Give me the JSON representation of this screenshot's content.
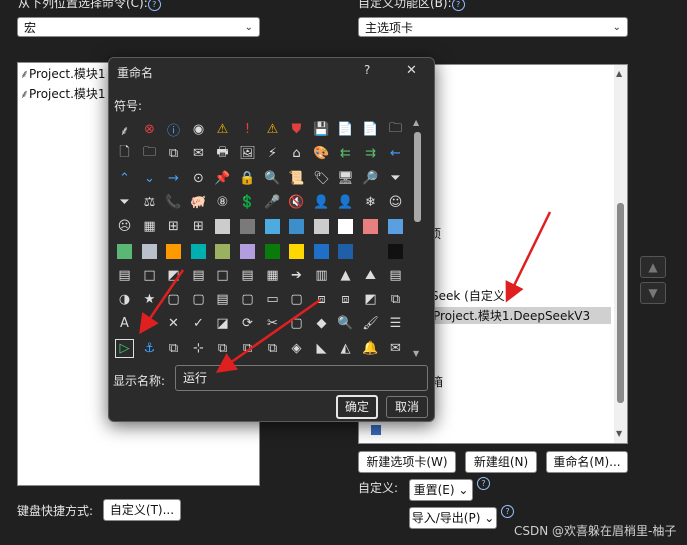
{
  "left_panel": {
    "label": "从下列位置选择命令(C):",
    "combo_value": "宏",
    "list_items": [
      "Project.模块1",
      "Project.模块1"
    ]
  },
  "right_panel": {
    "label": "自定义功能区(B):",
    "combo_value": "主选项卡",
    "list_items": [
      "项",
      "Seek (自定义)",
      "Project.模块1.DeepSeekV3",
      "箱"
    ],
    "buttons": {
      "new_tab": "新建选项卡(W)",
      "new_group": "新建组(N)",
      "rename": "重命名(M)..."
    },
    "customize_label": "自定义:",
    "reset": "重置(E)",
    "import_export": "导入/导出(P)"
  },
  "keyboard": {
    "label": "键盘快捷方式:",
    "button": "自定义(T)..."
  },
  "dialog": {
    "title": "重命名",
    "help": "?",
    "close": "✕",
    "symbol_label": "符号:",
    "display_name_label": "显示名称:",
    "display_name_value": "运行",
    "ok": "确定",
    "cancel": "取消",
    "symbols": [
      [
        "⸙",
        "⊗",
        "ⓘ",
        "◉",
        "⚠",
        "!",
        "⚠",
        "⛊",
        "💾",
        "📄",
        "📄",
        "🗀"
      ],
      [
        "🗋",
        "🗀",
        "⧉",
        "✉",
        "🖶",
        "🖼",
        "⚡",
        "⌂",
        "🎨",
        "⇇",
        "⇉",
        "←"
      ],
      [
        "⌃",
        "⌄",
        "→",
        "⊙",
        "📌",
        "🔒",
        "🔍",
        "📜",
        "🏷",
        "🖥",
        "🔎",
        "⏷"
      ],
      [
        "⏷",
        "⚖",
        "📞",
        "🐖",
        "⑧",
        "💲",
        "🎤",
        "🔇",
        "👤",
        "👤",
        "❄",
        "☺"
      ],
      [
        "☹",
        "▦",
        "⊞",
        "⊞",
        "⊞",
        "👤",
        "⊙",
        "👤",
        "▦",
        "□",
        "■",
        "■"
      ],
      [
        "■",
        "■",
        "■",
        "■",
        "■",
        "■",
        "■",
        "■",
        "■",
        "▩",
        "◪",
        "■"
      ],
      [
        "▤",
        "□",
        "◩",
        "▤",
        "□",
        "▤",
        "▦",
        "➔",
        "▥",
        "▲",
        "⛰",
        "▤"
      ],
      [
        "◑",
        "★",
        "▢",
        "▢",
        "▤",
        "▢",
        "▭",
        "▢",
        "⧈",
        "⧈",
        "◩",
        "⧉"
      ],
      [
        "A",
        "⚓",
        "✕",
        "✓",
        "◪",
        "⟳",
        "✂",
        "▢",
        "◆",
        "🔍",
        "🖌",
        "☰"
      ],
      [
        "▷",
        "⚓",
        "⧉",
        "⊹",
        "⧉",
        "⧉",
        "⧉",
        "◈",
        "◣",
        "◭",
        "🔔",
        "✉"
      ]
    ]
  },
  "colors": {
    "swatches_row4": [
      "#cccccc",
      "#7a7a7a",
      "#4dabe0",
      "#3d8fcc",
      "#cccccc",
      "#ffffff",
      "#e88080",
      "#5aa0e0"
    ],
    "swatches_row5": [
      "#5bb874",
      "#b8c0cc",
      "#ff9900",
      "#00b0b0",
      "#9bb060",
      "#b29ddf",
      "#0a7a0a",
      "#ffd700",
      "#1f6fc8",
      "#1f5fa8",
      "#2b2b2b",
      "#111111"
    ],
    "arrow": "#e02020",
    "accent": "#9ac0ff"
  },
  "watermark": "CSDN @欢喜躲在眉梢里-柚子"
}
